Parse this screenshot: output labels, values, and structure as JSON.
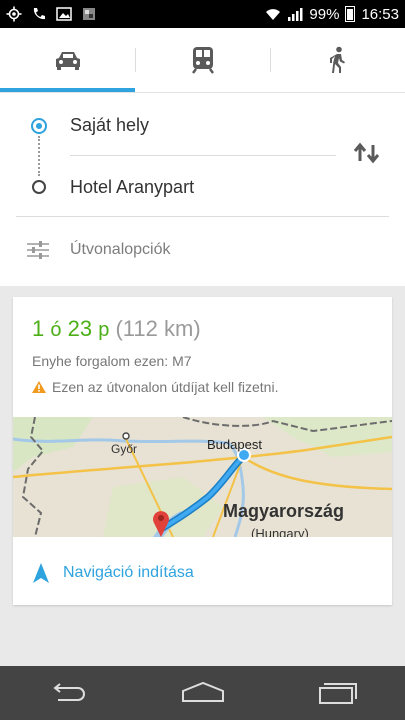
{
  "status": {
    "battery": "99%",
    "time": "16:53",
    "left_icons": [
      "location-icon",
      "phone-icon",
      "image-icon",
      "app-notification-icon"
    ],
    "right_icons": [
      "wifi-icon",
      "signal-icon",
      "battery-icon"
    ]
  },
  "modes": {
    "items": [
      {
        "name": "car",
        "icon": "car-icon",
        "active": true
      },
      {
        "name": "transit",
        "icon": "train-icon",
        "active": false
      },
      {
        "name": "walk",
        "icon": "walking-icon",
        "active": false
      }
    ],
    "accent": "#2ea3dd"
  },
  "route": {
    "from": "Saját hely",
    "to": "Hotel Aranypart",
    "options_label": "Útvonalopciók"
  },
  "result": {
    "hours": "1",
    "hours_unit": "ó",
    "minutes": "23",
    "minutes_unit": "p",
    "distance": "(112 km)",
    "traffic": "Enyhe forgalom ezen: M7",
    "warning": "Ezen az útvonalon útdíjat kell fizetni.",
    "navigation_label": "Navigáció indítása"
  },
  "map": {
    "city_gyor": "Győr",
    "city_budapest": "Budapest",
    "country": "Magyarország",
    "country_en": "(Hungary)"
  },
  "colors": {
    "accent": "#2ea3dd",
    "duration_green": "#4caf18",
    "warning": "#f09a1e",
    "navbar": "#444444"
  }
}
